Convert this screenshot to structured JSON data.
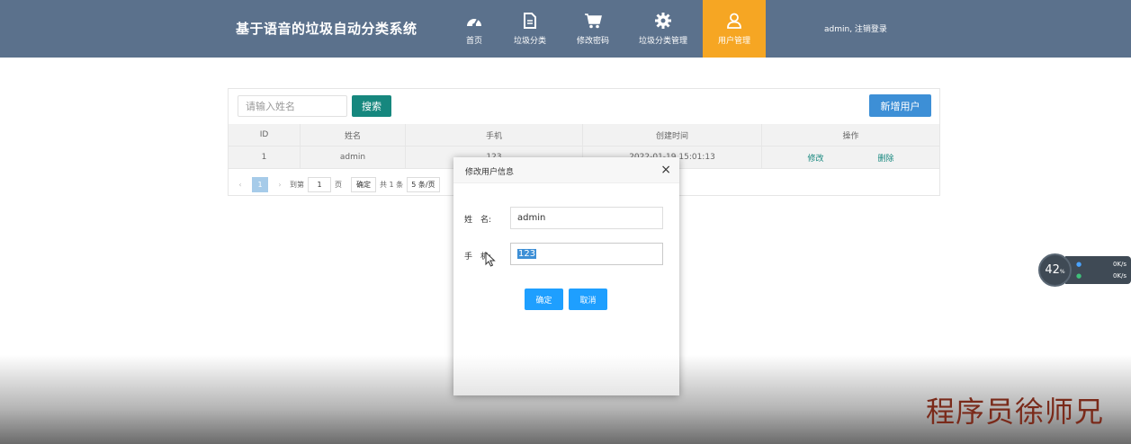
{
  "header": {
    "title": "基于语音的垃圾自动分类系统",
    "nav": [
      {
        "label": "首页",
        "icon": "dashboard-icon"
      },
      {
        "label": "垃圾分类",
        "icon": "document-icon"
      },
      {
        "label": "修改密码",
        "icon": "cart-icon"
      },
      {
        "label": "垃圾分类管理",
        "icon": "gear-icon"
      },
      {
        "label": "用户管理",
        "icon": "user-icon",
        "active": true
      }
    ],
    "user_info": "admin, 注销登录",
    "bg_color": "#5b718c",
    "active_color": "#f6a623"
  },
  "toolbar": {
    "search_placeholder": "请输入姓名",
    "search_label": "搜索",
    "add_label": "新增用户"
  },
  "table": {
    "columns": [
      "ID",
      "姓名",
      "手机",
      "创建时间",
      "操作"
    ],
    "rows": [
      {
        "id": "1",
        "name": "admin",
        "phone": "123",
        "created": "2022-01-19 15:01:13",
        "edit": "修改",
        "delete": "删除"
      }
    ]
  },
  "pagination": {
    "current": "1",
    "goto_prefix": "到第",
    "goto_value": "1",
    "goto_suffix": "页",
    "confirm": "确定",
    "total": "共 1 条",
    "page_size": "5 条/页"
  },
  "modal": {
    "title": "修改用户信息",
    "close": "×",
    "name_label": "姓　名:",
    "name_value": "admin",
    "phone_label": "手　机:",
    "phone_value": "123",
    "ok_label": "确定",
    "cancel_label": "取消"
  },
  "speed_widget": {
    "percent": "42",
    "percent_unit": "%",
    "upload": "0K/s",
    "download": "0K/s"
  },
  "watermark": "程序员徐师兄"
}
